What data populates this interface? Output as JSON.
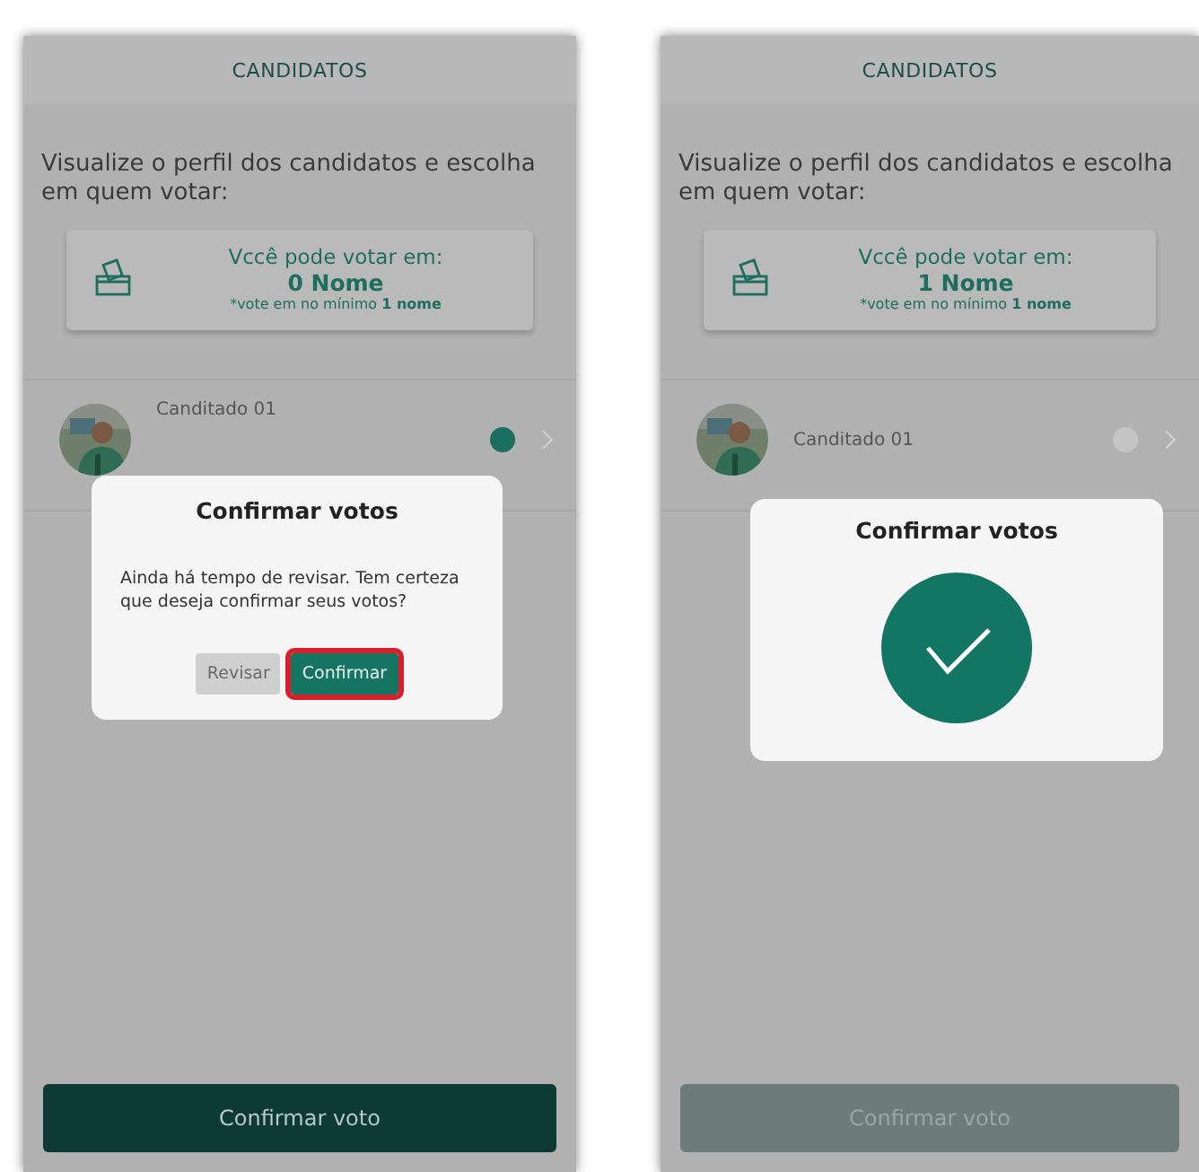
{
  "screens": [
    {
      "header": "CANDIDATOS",
      "intro": "Visualize o perfil dos candidatos e escolha em quem votar:",
      "vote_card": {
        "label": "Vccê pode votar em:",
        "count": "0 Nome",
        "note": "*vote em no mínimo **1 nome**"
      },
      "candidates": [
        {
          "name": "Canditado 01",
          "selected": true
        }
      ],
      "dialog": {
        "kind": "confirm",
        "title": "Confirmar votos",
        "message": "Ainda há tempo de revisar. Tem certeza que deseja confirmar seus votos?",
        "buttons": [
          {
            "label": "Revisar",
            "kind": "secondary",
            "highlighted": false
          },
          {
            "label": "Confirmar",
            "kind": "primary",
            "highlighted": true
          }
        ]
      },
      "submit": {
        "label": "Confirmar voto",
        "disabled": false
      }
    },
    {
      "header": "CANDIDATOS",
      "intro": "Visualize o perfil dos candidatos e escolha em quem votar:",
      "vote_card": {
        "label": "Vccê pode votar em:",
        "count": "1 Nome",
        "note": "*vote em no mínimo **1 nome**"
      },
      "candidates": [
        {
          "name": "Canditado 01",
          "selected": false
        }
      ],
      "dialog": {
        "kind": "success",
        "title": "Confirmar votos"
      },
      "submit": {
        "label": "Confirmar voto",
        "disabled": true
      }
    }
  ]
}
